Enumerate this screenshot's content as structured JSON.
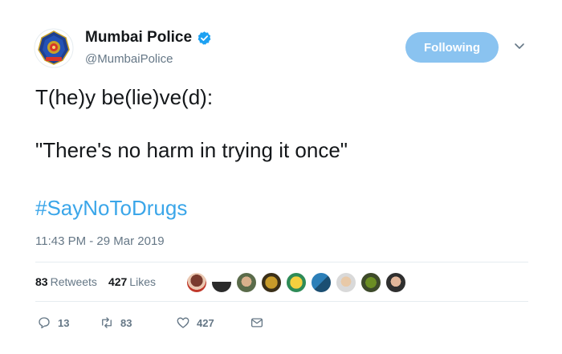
{
  "tweet": {
    "author": {
      "name": "Mumbai Police",
      "handle": "@MumbaiPolice",
      "verified": true,
      "avatar_icon": "mumbai-police-emblem-icon"
    },
    "follow_button_label": "Following",
    "text_line1": "T(he)y be(lie)ve(d):",
    "text_line2": "\"There's no harm in trying it once\"",
    "hashtag": "#SayNoToDrugs",
    "timestamp": "11:43 PM - 29 Mar 2019",
    "stats": {
      "retweets_count": "83",
      "retweets_label": "Retweets",
      "likes_count": "427",
      "likes_label": "Likes"
    },
    "likers_count": 9,
    "actions": {
      "reply_count": "13",
      "retweet_count": "83",
      "like_count": "427"
    }
  },
  "colors": {
    "accent": "#1da1f2",
    "hashtag": "#3ba6e9",
    "follow_button_bg": "#8ac3f0",
    "secondary_text": "#657786"
  }
}
